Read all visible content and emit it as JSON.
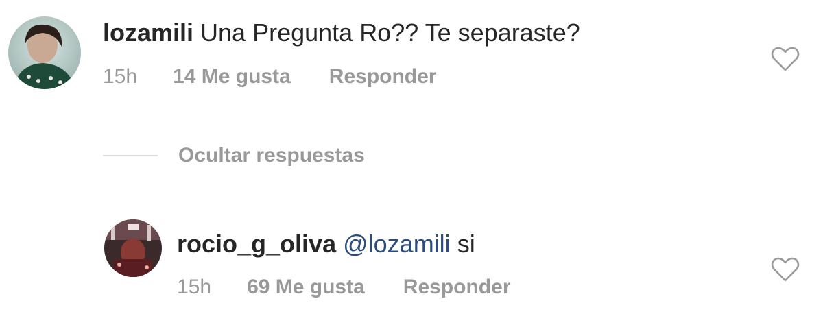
{
  "comments": [
    {
      "username": "lozamili",
      "mention": "",
      "text": " Una Pregunta Ro?? Te separaste?",
      "time": "15h",
      "likes": "14 Me gusta",
      "reply": "Responder",
      "avatar_icon": "profile-photo-icon"
    },
    {
      "username": "rocio_g_oliva",
      "mention": "@lozamili",
      "text": " si",
      "time": "15h",
      "likes": "69 Me gusta",
      "reply": "Responder",
      "avatar_icon": "profile-photo-icon"
    }
  ],
  "replies_toggle": {
    "label": "Ocultar respuestas"
  },
  "like_icon": "heart-outline-icon",
  "colors": {
    "text": "#262626",
    "muted": "#999999",
    "mention": "#2b4c7e",
    "divider": "#dbdbdb"
  }
}
